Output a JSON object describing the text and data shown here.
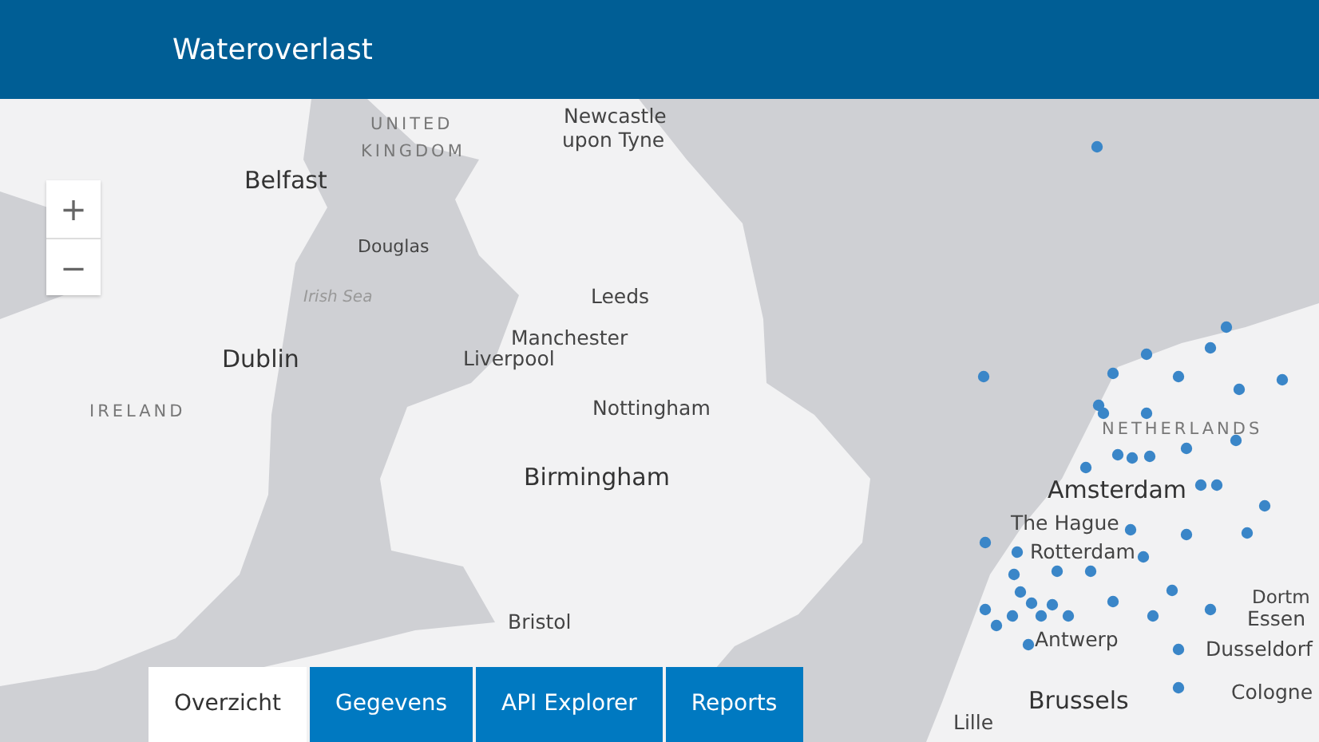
{
  "header": {
    "title": "Wateroverlast"
  },
  "zoom_controls": {
    "zoom_in": "+",
    "zoom_out": "−"
  },
  "map_labels": [
    {
      "text": "UNITED",
      "kind": "country"
    },
    {
      "text": "KINGDOM",
      "kind": "country"
    },
    {
      "text": "Newcastle",
      "kind": "city"
    },
    {
      "text": "upon Tyne",
      "kind": "city"
    },
    {
      "text": "Belfast",
      "kind": "capital"
    },
    {
      "text": "Douglas",
      "kind": "small"
    },
    {
      "text": "Irish Sea",
      "kind": "sea"
    },
    {
      "text": "Leeds",
      "kind": "city"
    },
    {
      "text": "Manchester",
      "kind": "city"
    },
    {
      "text": "Liverpool",
      "kind": "city"
    },
    {
      "text": "Dublin",
      "kind": "capital"
    },
    {
      "text": "IRELAND",
      "kind": "country"
    },
    {
      "text": "Nottingham",
      "kind": "city"
    },
    {
      "text": "Birmingham",
      "kind": "capital"
    },
    {
      "text": "Bristol",
      "kind": "city"
    },
    {
      "text": "NETHERLANDS",
      "kind": "country"
    },
    {
      "text": "Amsterdam",
      "kind": "capital"
    },
    {
      "text": "The Hague",
      "kind": "city"
    },
    {
      "text": "Rotterdam",
      "kind": "city"
    },
    {
      "text": "Dortm",
      "kind": "city"
    },
    {
      "text": "Essen",
      "kind": "city"
    },
    {
      "text": "Antwerp",
      "kind": "city"
    },
    {
      "text": "Dusseldorf",
      "kind": "city"
    },
    {
      "text": "Brussels",
      "kind": "capital"
    },
    {
      "text": "Cologne",
      "kind": "city"
    },
    {
      "text": "Lille",
      "kind": "city"
    }
  ],
  "tabs": [
    {
      "label": "Overzicht",
      "selected": true
    },
    {
      "label": "Gegevens",
      "selected": false
    },
    {
      "label": "API Explorer",
      "selected": false
    },
    {
      "label": "Reports",
      "selected": false
    }
  ]
}
